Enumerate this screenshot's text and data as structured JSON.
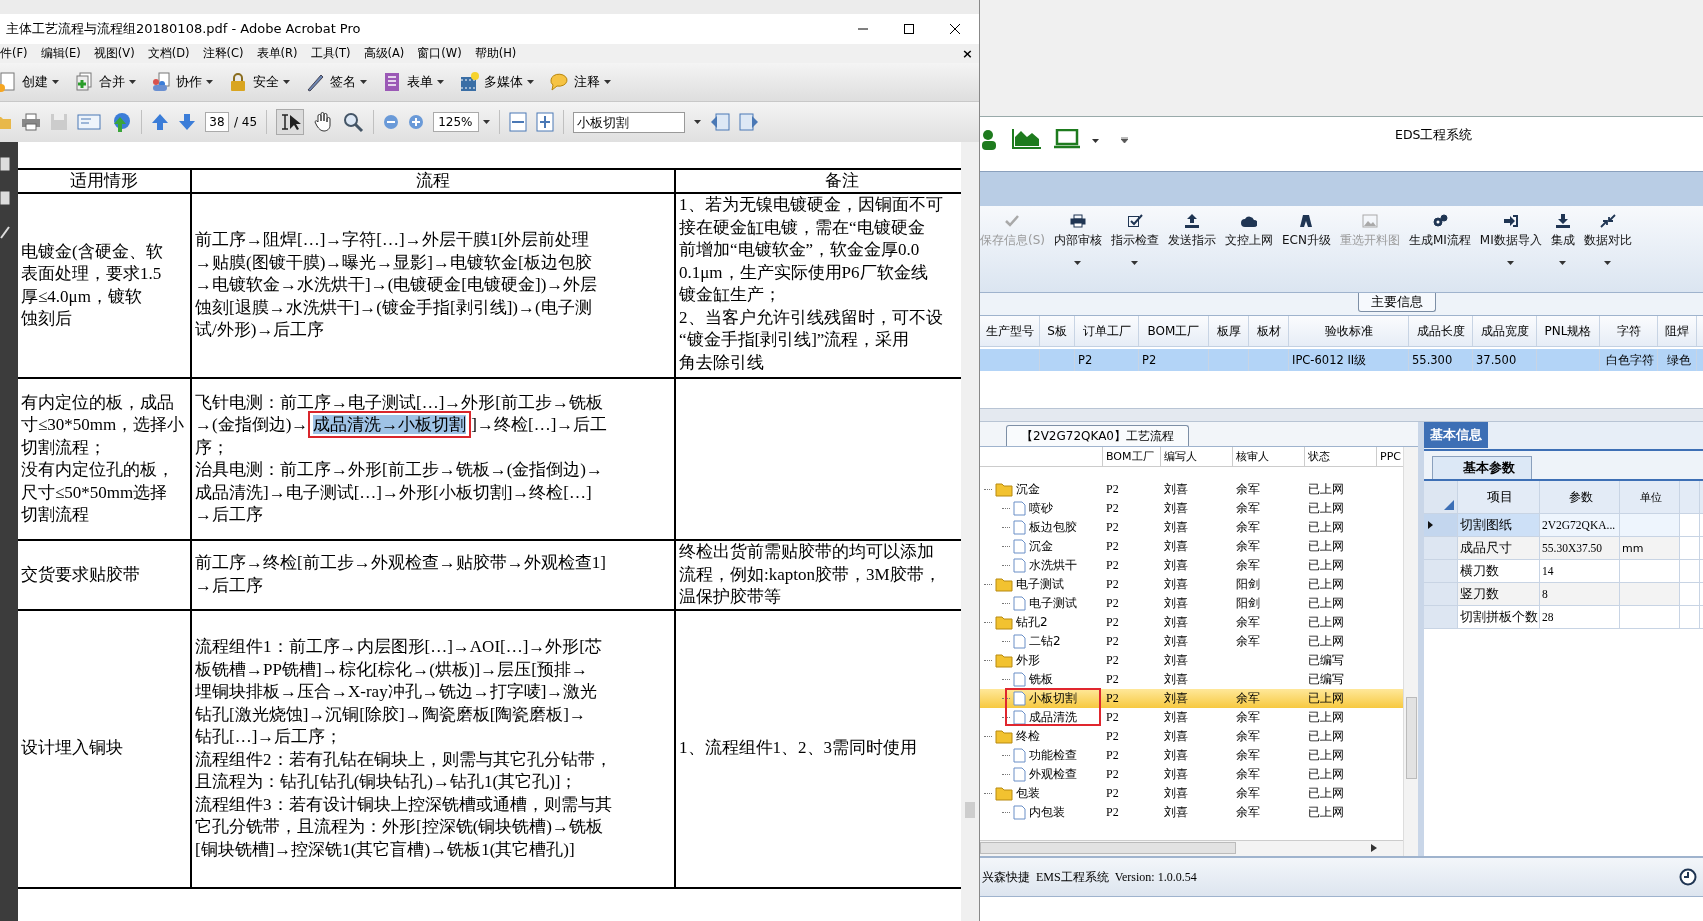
{
  "pdf_window": {
    "title": "主体工艺流程与流程组20180108.pdf - Adobe Acrobat Pro",
    "menu": [
      "件(F)",
      "编辑(E)",
      "视图(V)",
      "文档(D)",
      "注释(C)",
      "表单(R)",
      "工具(T)",
      "高级(A)",
      "窗口(W)",
      "帮助(H)"
    ],
    "menu_close": "×",
    "tools": [
      {
        "kind": "create",
        "label": "创建"
      },
      {
        "kind": "combine",
        "label": "合并"
      },
      {
        "kind": "collaborate",
        "label": "协作"
      },
      {
        "kind": "secure",
        "label": "安全"
      },
      {
        "kind": "sign",
        "label": "签名"
      },
      {
        "kind": "forms",
        "label": "表单"
      },
      {
        "kind": "multimedia",
        "label": "多媒体"
      },
      {
        "kind": "comment",
        "label": "注释"
      }
    ],
    "page_field": "38",
    "page_total": "/ 45",
    "zoom_field": "125%",
    "search_field": "小板切割",
    "table": {
      "columns": [
        "适用情形",
        "流程",
        "备注"
      ],
      "rows": [
        {
          "cells": [
            [
              "电镀金(含硬金、软",
              "表面处理，要求1.5",
              "厚≤4.0μm，镀软",
              "蚀刻后"
            ],
            [
              "前工序→阻焊[…]→字符[…]→外层干膜1[外层前处理",
              "→贴膜(图镀干膜)→曝光→显影]→电镀软金[板边包胶",
              "→电镀软金→水洗烘干]→(电镀硬金[电镀硬金])→外层",
              "蚀刻[退膜→水洗烘干]→(镀金手指[剥引线])→(电子测",
              "试/外形)→后工序"
            ],
            [
              "1、若为无镍电镀硬金，因铜面不可",
              "接在硬金缸电镀，需在“电镀硬金",
              "前增加“电镀软金”，软金金厚0.0",
              "0.1μm，生产实际使用P6厂软金线",
              "镀金缸生产；",
              "2、当客户允许引线残留时，可不设",
              "“镀金手指[剥引线]”流程，采用",
              "角去除引线"
            ]
          ]
        },
        {
          "cells": [
            [
              "有内定位的板，成品",
              "寸≤30*50mm，选择小",
              "切割流程；",
              "没有内定位孔的板，",
              "尺寸≤50*50mm选择",
              "切割流程"
            ],
            [
              "飞针电测：前工序→电子测试[…]→外形[前工步→铣板",
              {
                "before": "→(金指倒边)→",
                "highlight": "成品清洗→小板切割",
                "after": "]→终检[…]→后工"
              },
              "序；",
              "治具电测：前工序→外形[前工步→铣板→(金指倒边)→",
              "成品清洗]→电子测试[…]→外形[小板切割]→终检[…]",
              "→后工序"
            ],
            []
          ]
        },
        {
          "cells": [
            [
              "交货要求贴胶带"
            ],
            [
              "前工序→终检[前工步→外观检查→贴胶带→外观检查1]",
              "→后工序"
            ],
            [
              "终检出货前需贴胶带的均可以添加",
              "流程，例如:kapton胶带，3M胶带，",
              "温保护胶带等"
            ]
          ]
        },
        {
          "cells": [
            [
              "设计埋入铜块"
            ],
            [
              "流程组件1：前工序→内层图形[…]→AOI[…]→外形[芯",
              "板铣槽→PP铣槽]→棕化[棕化→(烘板)]→层压[预排→",
              "埋铜块排板→压合→X-ray冲孔→铣边→打字唛]→激光",
              "钻孔[激光烧蚀]→沉铜[除胶]→陶瓷磨板[陶瓷磨板]→",
              "钻孔[…]→后工序；",
              "流程组件2：若有孔钻在铜块上，则需与其它孔分钻带，",
              "且流程为：钻孔[钻孔(铜块钻孔)→钻孔1(其它孔)]；",
              "流程组件3：若有设计铜块上控深铣槽或通槽，则需与其",
              "它孔分铣带，且流程为：外形[控深铣(铜块铣槽)→铣板",
              "[铜块铣槽]→控深铣1(其它盲槽)→铣板1(其它槽孔)]"
            ],
            [
              "1、流程组件1、2、3需同时使用"
            ]
          ]
        }
      ]
    }
  },
  "ems_window": {
    "title": "EDS工程系统",
    "ribbon": [
      {
        "kind": "save",
        "label": "保存信息(S)",
        "disabled": true,
        "dropdown": false
      },
      {
        "kind": "print",
        "label": "内部审核",
        "disabled": false,
        "dropdown": true
      },
      {
        "kind": "check",
        "label": "指示检查",
        "disabled": false,
        "dropdown": true
      },
      {
        "kind": "upload",
        "label": "发送指示",
        "disabled": false,
        "dropdown": false
      },
      {
        "kind": "cloud",
        "label": "文控上网",
        "disabled": false,
        "dropdown": false
      },
      {
        "kind": "ecn",
        "label": "ECN升级",
        "disabled": false,
        "dropdown": false
      },
      {
        "kind": "image",
        "label": "重选开料图",
        "disabled": true,
        "dropdown": false
      },
      {
        "kind": "gears",
        "label": "生成MI流程",
        "disabled": false,
        "dropdown": false
      },
      {
        "kind": "import",
        "label": "MI数据导入",
        "disabled": false,
        "dropdown": true
      },
      {
        "kind": "download",
        "label": "集成",
        "disabled": false,
        "dropdown": true
      },
      {
        "kind": "compare",
        "label": "数据对比",
        "disabled": false,
        "dropdown": true
      }
    ],
    "main_tab": "主要信息",
    "main_grid": {
      "columns": [
        "生产型号",
        "S板",
        "订单工厂",
        "BOM工厂",
        "板厚",
        "板材",
        "验收标准",
        "成品长度",
        "成品宽度",
        "PNL规格",
        "字符",
        "阻焊"
      ],
      "rows": [
        {
          "selected": true,
          "cells": [
            null,
            null,
            "P2",
            "P2",
            null,
            null,
            "IPC-6012 II级",
            "55.300",
            "37.500",
            null,
            "白色字符",
            "绿色"
          ]
        }
      ]
    },
    "flow_tab": "【2V2G72QKA0】工艺流程",
    "flow_columns": [
      "BOM工厂",
      "编写人",
      "核审人",
      "状态",
      "PPC"
    ],
    "flow_tree": [
      {
        "kind": "folder",
        "name": "沉金",
        "cells": [
          "P2",
          "刘喜",
          "余军",
          "已上网"
        ],
        "selected": false,
        "children": [
          {
            "kind": "step",
            "name": "喷砂",
            "cells": [
              "P2",
              "刘喜",
              "余军",
              "已上网"
            ],
            "selected": false
          },
          {
            "kind": "step",
            "name": "板边包胶",
            "cells": [
              "P2",
              "刘喜",
              "余军",
              "已上网"
            ],
            "selected": false
          },
          {
            "kind": "step",
            "name": "沉金",
            "cells": [
              "P2",
              "刘喜",
              "余军",
              "已上网"
            ],
            "selected": false
          },
          {
            "kind": "step",
            "name": "水洗烘干",
            "cells": [
              "P2",
              "刘喜",
              "余军",
              "已上网"
            ],
            "selected": false
          }
        ]
      },
      {
        "kind": "folder",
        "name": "电子测试",
        "cells": [
          "P2",
          "刘喜",
          "阳剑",
          "已上网"
        ],
        "selected": false,
        "children": [
          {
            "kind": "step",
            "name": "电子测试",
            "cells": [
              "P2",
              "刘喜",
              "阳剑",
              "已上网"
            ],
            "selected": false
          }
        ]
      },
      {
        "kind": "folder",
        "name": "钻孔2",
        "cells": [
          "P2",
          "刘喜",
          "余军",
          "已上网"
        ],
        "selected": false,
        "children": [
          {
            "kind": "step",
            "name": "二钻2",
            "cells": [
              "P2",
              "刘喜",
              "余军",
              "已上网"
            ],
            "selected": false
          }
        ]
      },
      {
        "kind": "folder",
        "name": "外形",
        "cells": [
          "P2",
          "刘喜",
          null,
          "已编写"
        ],
        "selected": false,
        "children": [
          {
            "kind": "step",
            "name": "铣板",
            "cells": [
              "P2",
              "刘喜",
              null,
              "已编写"
            ],
            "selected": false
          },
          {
            "kind": "step",
            "name": "小板切割",
            "cells": [
              "P2",
              "刘喜",
              "余军",
              "已上网"
            ],
            "selected": true
          },
          {
            "kind": "step",
            "name": "成品清洗",
            "cells": [
              "P2",
              "刘喜",
              "余军",
              "已上网"
            ],
            "selected": false
          }
        ]
      },
      {
        "kind": "folder",
        "name": "终检",
        "cells": [
          "P2",
          "刘喜",
          "余军",
          "已上网"
        ],
        "selected": false,
        "children": [
          {
            "kind": "step",
            "name": "功能检查",
            "cells": [
              "P2",
              "刘喜",
              "余军",
              "已上网"
            ],
            "selected": false
          },
          {
            "kind": "step",
            "name": "外观检查",
            "cells": [
              "P2",
              "刘喜",
              "余军",
              "已上网"
            ],
            "selected": false
          }
        ]
      },
      {
        "kind": "folder",
        "name": "包装",
        "cells": [
          "P2",
          "刘喜",
          "余军",
          "已上网"
        ],
        "selected": false,
        "children": [
          {
            "kind": "step",
            "name": "内包装",
            "cells": [
              "P2",
              "刘喜",
              "余军",
              "已上网"
            ],
            "selected": false
          }
        ]
      }
    ],
    "info_tab": "基本信息",
    "param_tab": "基本参数",
    "param_grid": {
      "columns": [
        "项目",
        "参数",
        "单位"
      ],
      "rows": [
        {
          "selected": true,
          "cells": [
            "切割图纸",
            "2V2G72QKA...",
            null
          ]
        },
        {
          "selected": false,
          "cells": [
            "成品尺寸",
            "55.30X37.50",
            "mm"
          ]
        },
        {
          "selected": false,
          "cells": [
            "横刀数",
            "14",
            null
          ]
        },
        {
          "selected": false,
          "cells": [
            "竖刀数",
            "8",
            null
          ]
        },
        {
          "selected": false,
          "cells": [
            "切割拼板个数",
            "28",
            null
          ]
        }
      ]
    },
    "status": "兴森快捷  EMS工程系统  Version: 1.0.0.54"
  }
}
